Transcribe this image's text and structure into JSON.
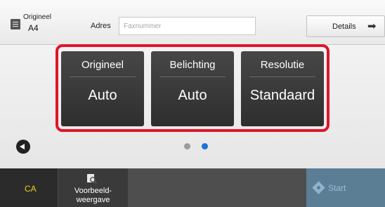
{
  "header": {
    "original_label": "Origineel",
    "original_size": "A4",
    "address_label": "Adres",
    "fax_placeholder": "Faxnummer",
    "fax_value": "",
    "details_label": "Details"
  },
  "functions": [
    {
      "label": "Origineel",
      "value": "Auto"
    },
    {
      "label": "Belichting",
      "value": "Auto"
    },
    {
      "label": "Resolutie",
      "value": "Standaard"
    }
  ],
  "pager": {
    "total_pages": 2,
    "active_page": 2
  },
  "bottom": {
    "ca_label": "CA",
    "preview_label_line1": "Voorbeeld-",
    "preview_label_line2": "weergave",
    "start_label": "Start"
  },
  "colors": {
    "highlight_frame": "#e0142a",
    "active_dot": "#1a74d6",
    "ca_text": "#f2cf16",
    "start_button": "#5b7e95"
  },
  "icons": {
    "original": "document-icon",
    "details": "arrow-right-icon",
    "prev": "chevron-left-icon",
    "preview": "magnifier-icon",
    "start": "start-diamond-icon"
  }
}
